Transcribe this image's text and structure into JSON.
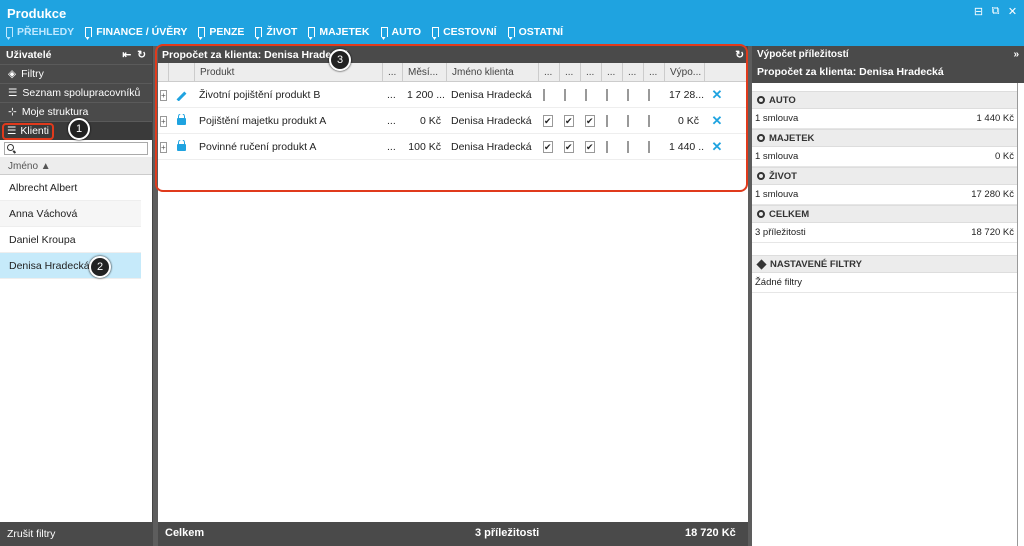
{
  "app": {
    "title": "Produkce"
  },
  "nav": [
    {
      "label": "PŘEHLEDY",
      "active": true
    },
    {
      "label": "FINANCE / ÚVĚRY"
    },
    {
      "label": "PENZE"
    },
    {
      "label": "ŽIVOT"
    },
    {
      "label": "MAJETEK"
    },
    {
      "label": "AUTO"
    },
    {
      "label": "CESTOVNÍ"
    },
    {
      "label": "OSTATNÍ"
    }
  ],
  "left": {
    "title": "Uživatelé",
    "menu": {
      "filtry": "Filtry",
      "seznam": "Seznam spolupracovníků",
      "struktura": "Moje struktura",
      "klienti": "Klienti"
    },
    "column": "Jméno ▲",
    "clients": [
      "Albrecht Albert",
      "Anna Váchová",
      "Daniel Kroupa",
      "Denisa Hradecká"
    ],
    "footer": "Zrušit filtry"
  },
  "center": {
    "title": "Propočet za klienta: Denisa Hradecká",
    "columns": {
      "produkt": "Produkt",
      "dots": "...",
      "mesicne": "Měsí...",
      "jmeno": "Jméno klienta",
      "vypocet": "Výpo..."
    },
    "rows": [
      {
        "produkt": "Životní pojištění produkt B",
        "dots": "...",
        "mesicne": "1 200 ...",
        "jmeno": "Denisa Hradecká",
        "vypocet": "17 28..."
      },
      {
        "produkt": "Pojištění majetku produkt A",
        "dots": "...",
        "mesicne": "0 Kč",
        "jmeno": "Denisa Hradecká",
        "vypocet": "0 Kč"
      },
      {
        "produkt": "Povinné ručení produkt A",
        "dots": "...",
        "mesicne": "100 Kč",
        "jmeno": "Denisa Hradecká",
        "vypocet": "1 440 ..."
      }
    ],
    "footer": {
      "label": "Celkem",
      "count": "3 příležitosti",
      "total": "18 720 Kč"
    }
  },
  "right": {
    "title": "Výpočet příležitostí",
    "subtitle": "Propočet za klienta: Denisa Hradecká",
    "sections": [
      {
        "head": "AUTO",
        "left": "1 smlouva",
        "right": "1 440 Kč"
      },
      {
        "head": "MAJETEK",
        "left": "1 smlouva",
        "right": "0 Kč"
      },
      {
        "head": "ŽIVOT",
        "left": "1 smlouva",
        "right": "17 280 Kč"
      },
      {
        "head": "CELKEM",
        "left": "3 příležitosti",
        "right": "18 720 Kč"
      }
    ],
    "filters": {
      "head": "NASTAVENÉ FILTRY",
      "value": "Žádné filtry"
    }
  },
  "badges": {
    "one": "1",
    "two": "2",
    "three": "3"
  },
  "colors": {
    "accent": "#1fa3e0",
    "callout": "#e03a1c",
    "panel": "#4a4a4a"
  }
}
